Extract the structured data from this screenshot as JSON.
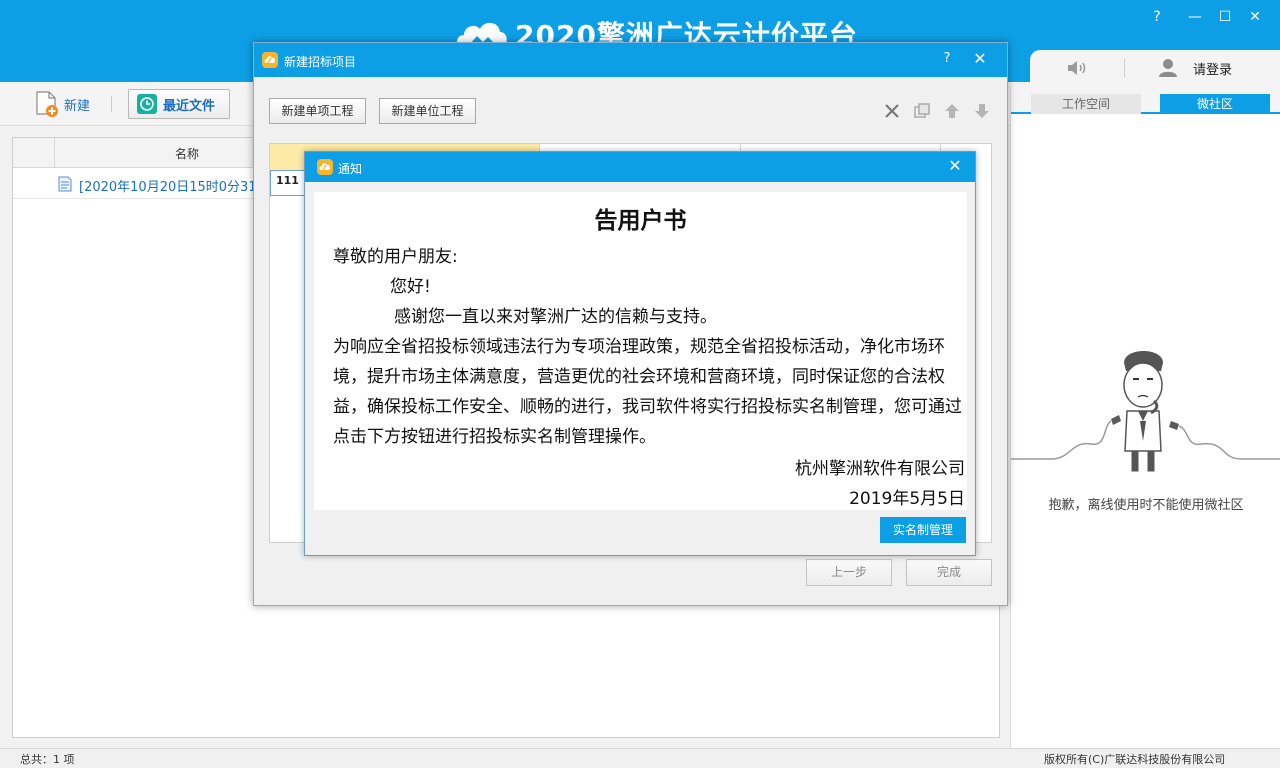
{
  "app": {
    "title": "2020擎洲广达云计价平台",
    "window_controls": {
      "help": "?",
      "minimize": "—",
      "maximize": "☐",
      "close": "✕"
    },
    "login_label": "请登录"
  },
  "toolbar": {
    "new_label": "新建",
    "recent_label": "最近文件"
  },
  "file_list": {
    "columns": [
      "名称"
    ],
    "rows": [
      {
        "name": "[2020年10月20日15时0分31"
      }
    ]
  },
  "right_panel": {
    "tabs": [
      {
        "label": "工作空间"
      },
      {
        "label": "微社区"
      }
    ],
    "active_tab": "微社区",
    "offline_message": "抱歉，离线使用时不能使用微社区"
  },
  "status": {
    "total": "总共：1 项",
    "copyright": "版权所有(C)广联达科技股份有限公司"
  },
  "dialog_project": {
    "title": "新建招标项目",
    "help": "?",
    "close": "✕",
    "buttons": {
      "new_item": "新建单项工程",
      "new_unit": "新建单位工程"
    },
    "icons": [
      "delete-icon",
      "copy-icon",
      "move-up-icon",
      "move-down-icon"
    ],
    "tree_cell_value": "111",
    "footer": {
      "prev": "上一步",
      "finish": "完成"
    }
  },
  "dialog_notice": {
    "title": "通知",
    "close": "✕",
    "heading": "告用户书",
    "salutation": "尊敬的用户朋友:",
    "greeting": "您好!",
    "thanks": "感谢您一直以来对擎洲广达的信赖与支持。",
    "paragraph": "为响应全省招投标领域违法行为专项治理政策，规范全省招投标活动，净化市场环境，提升市场主体满意度，营造更优的社会环境和营商环境，同时保证您的合法权益，确保投标工作安全、顺畅的进行，我司软件将实行招投标实名制管理，您可通过点击下方按钮进行招投标实名制管理操作。",
    "company": "杭州擎洲软件有限公司",
    "date": "2019年5月5日",
    "button": "实名制管理"
  },
  "colors": {
    "brand_blue": "#0d9fe6",
    "link_blue": "#1a6fc2",
    "tree_header_yellow": "#fdeaa6"
  }
}
